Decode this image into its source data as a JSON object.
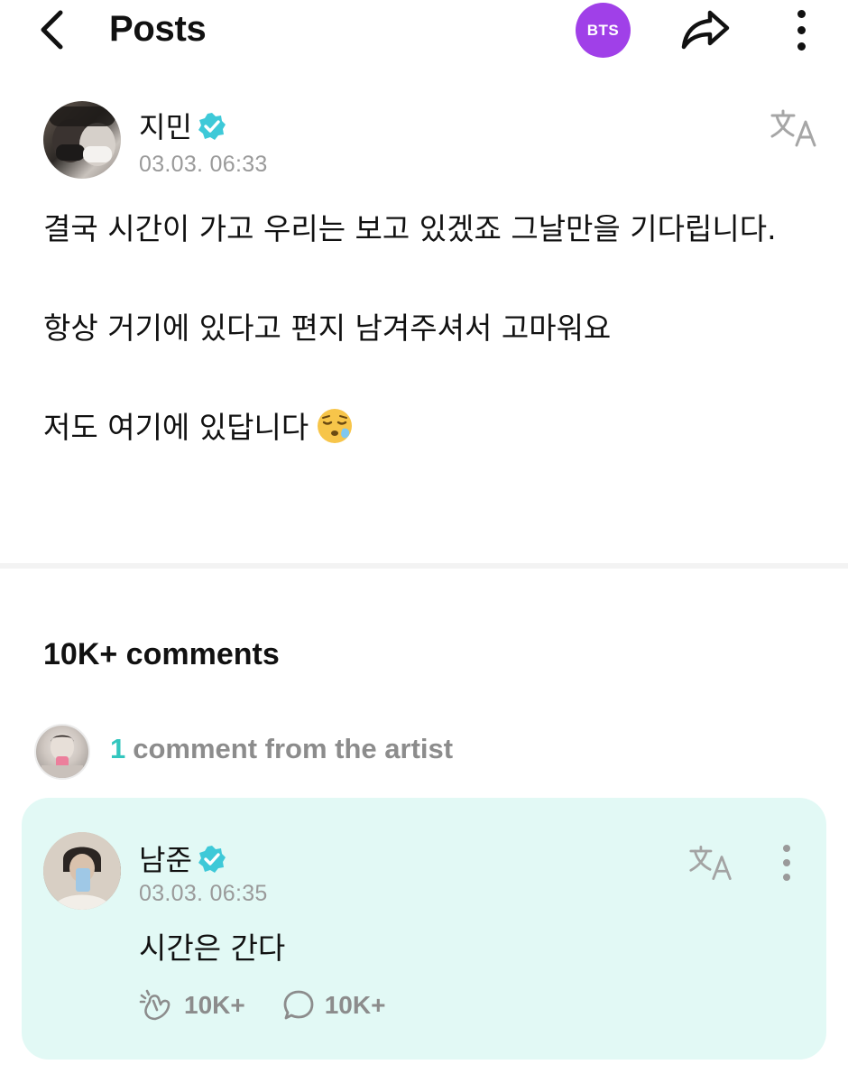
{
  "header": {
    "title": "Posts",
    "community_badge": "BTS",
    "badge_color": "#a040e8"
  },
  "post": {
    "author_name": "지민",
    "verified": true,
    "timestamp": "03.03. 06:33",
    "paragraphs": [
      "결국 시간이 가고 우리는 보고 있겠죠 그날만을 기다립니다.",
      "항상 거기에 있다고 편지 남겨주셔서 고마워요",
      "저도 여기에 있답니다"
    ],
    "emoji": "sleepy-face"
  },
  "comments": {
    "count_label": "10K+ comments",
    "artist_summary": {
      "count": "1",
      "label": "comment from the artist"
    },
    "artist_comment": {
      "author_name": "남준",
      "verified": true,
      "timestamp": "03.03. 06:35",
      "text": "시간은 간다",
      "likes": "10K+",
      "replies": "10K+",
      "card_color": "#e2f9f5"
    }
  },
  "colors": {
    "accent": "#33c6be",
    "verified": "#3ec9d8",
    "muted_text": "#9a9a9a"
  }
}
